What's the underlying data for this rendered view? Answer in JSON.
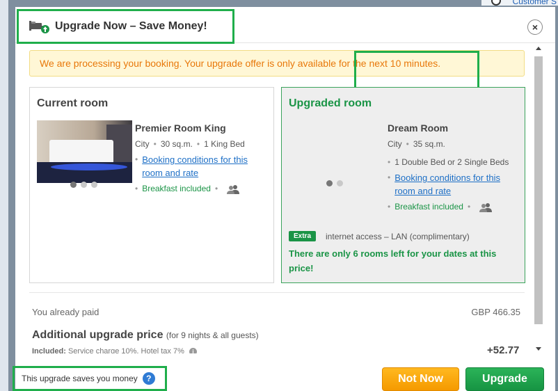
{
  "background": {
    "top_right_link": "Customer S"
  },
  "header": {
    "title": "Upgrade Now – Save Money!",
    "close_label": "×"
  },
  "alert": {
    "text": "We are processing your booking. Your upgrade offer is only available for the next 10 minutes."
  },
  "current_room": {
    "heading": "Current room",
    "name": "Premier Room King",
    "view": "City",
    "size": "30 sq.m.",
    "beds": "1 King Bed",
    "conditions_link": "Booking conditions for this room and rate",
    "breakfast": "Breakfast included",
    "photo_count": 3
  },
  "upgraded_room": {
    "heading": "Upgraded room",
    "name": "Dream Room",
    "view": "City",
    "size": "35 sq.m.",
    "beds": "1 Double Bed or 2 Single Beds",
    "conditions_link": "Booking conditions for this room and rate",
    "breakfast": "Breakfast included",
    "extra_badge": "Extra",
    "extra_text": "internet access – LAN (complimentary)",
    "scarcity": "There are only 6 rooms left for your dates at this price!",
    "photo_count": 2
  },
  "pricing": {
    "paid_label": "You already paid",
    "paid_value": "GBP 466.35",
    "upgrade_label": "Additional upgrade price",
    "upgrade_note": "(for 9 nights & all guests)",
    "included_label": "Included:",
    "included_text": "Service charge 10%, Hotel tax 7%",
    "upgrade_value": "+52.77"
  },
  "footer": {
    "saves_text": "This upgrade saves you money",
    "help_label": "?",
    "not_now_label": "Not Now",
    "upgrade_label": "Upgrade"
  },
  "colors": {
    "accent_green": "#1a9446",
    "alert_orange": "#e8780a",
    "link_blue": "#1d6fc6",
    "annotation_green": "#1fae4b"
  }
}
